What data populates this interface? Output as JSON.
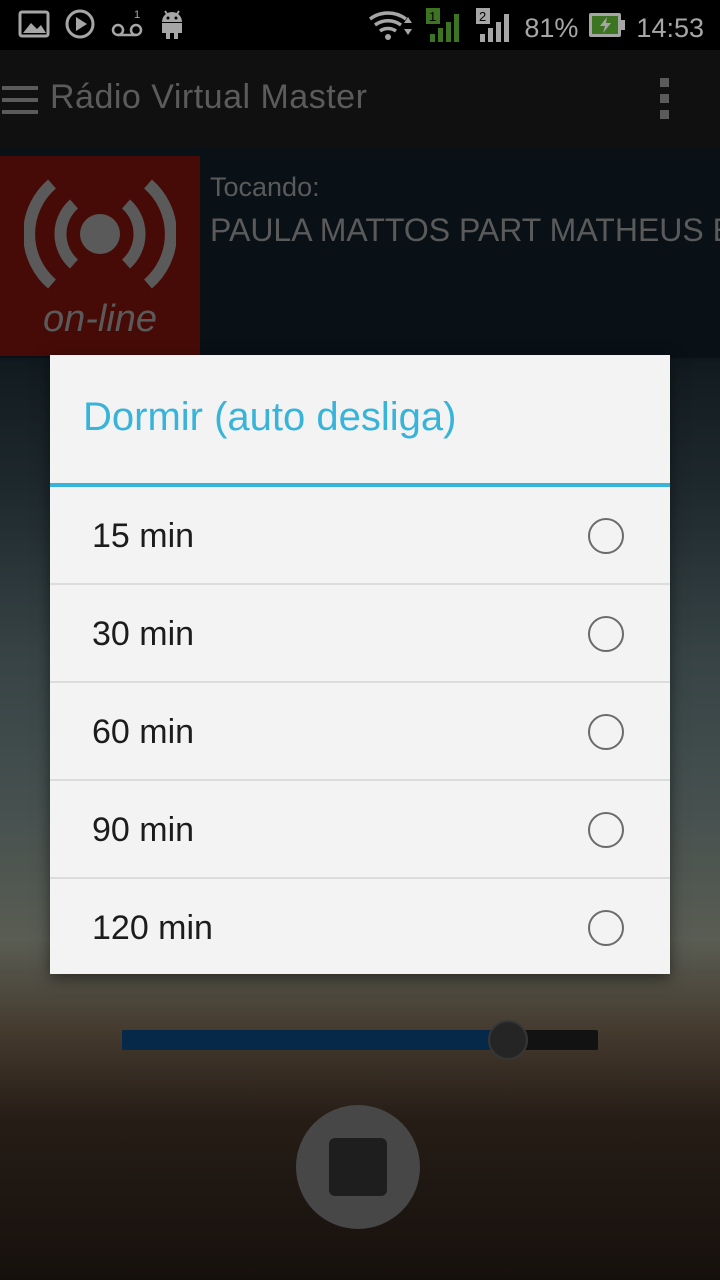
{
  "statusbar": {
    "battery": "81%",
    "time": "14:53",
    "sim1": "1",
    "sim2": "2",
    "icons": [
      "image-icon",
      "play-circle-icon",
      "voicemail-icon",
      "android-icon",
      "wifi-icon",
      "signal-icon",
      "battery-charging-icon"
    ]
  },
  "appbar": {
    "title": "Rádio Virtual Master",
    "menu_icon": "hamburger-menu-icon",
    "overflow_icon": "more-vert-icon"
  },
  "player": {
    "live_label": "on-line",
    "live_icon": "broadcast-icon",
    "tocando_label": "Tocando:",
    "now_playing": "PAULA MATTOS PART MATHEUS E KAUAN",
    "volume_fraction": 0.81,
    "stop_icon": "stop-icon"
  },
  "dialog": {
    "title": "Dormir (auto desliga)",
    "options": [
      {
        "label": "15 min",
        "selected": false
      },
      {
        "label": "30 min",
        "selected": false
      },
      {
        "label": "60 min",
        "selected": false
      },
      {
        "label": "90 min",
        "selected": false
      },
      {
        "label": "120 min",
        "selected": false
      }
    ]
  },
  "colors": {
    "accent": "#38b3d9",
    "live_bg": "#6e120b",
    "slider_fill": "#0a3f72"
  }
}
